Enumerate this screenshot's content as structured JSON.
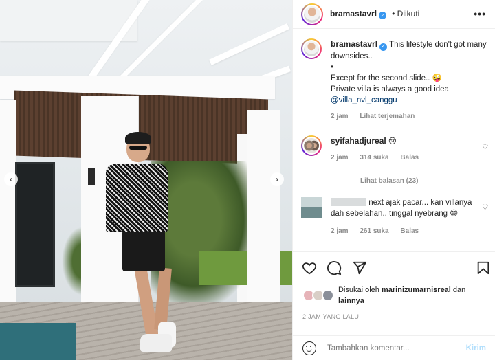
{
  "post": {
    "username": "bramastavrl",
    "follow_status": "Diikuti",
    "more_icon": "more-horizontal-icon",
    "caption": {
      "line1": "This lifestyle don't got many downsides..",
      "bullet": "•",
      "line2": "Except for the second slide..",
      "emoji1": "🤪",
      "line3": "Private villa is always a good idea",
      "mention": "@villa_nvl_canggu",
      "time": "2 jam",
      "translate": "Lihat terjemahan"
    },
    "comments": [
      {
        "username": "syifahadjureal",
        "emoji": "😢",
        "time": "2 jam",
        "likes": "314 suka",
        "reply": "Balas",
        "view_replies": "Lihat balasan (23)"
      },
      {
        "text_visible": "next ajak pacar... kan villanya dah sebelahan.. tinggal nyebrang",
        "emoji": "😄",
        "time": "2 jam",
        "likes": "261 suka",
        "reply": "Balas"
      }
    ],
    "liked_by_prefix": "Disukai oleh",
    "liked_by_user": "marinizumarnisreal",
    "liked_by_and": "dan",
    "liked_by_others": "lainnya",
    "timestamp": "2 JAM YANG LALU",
    "composer": {
      "placeholder": "Tambahkan komentar...",
      "send_label": "Kirim"
    },
    "carousel": {
      "prev": "‹",
      "next": "›"
    }
  },
  "colors": {
    "verified": "#3897f0",
    "link": "#00376b",
    "muted": "#8e8e8e",
    "send_disabled": "#b2dffc"
  }
}
